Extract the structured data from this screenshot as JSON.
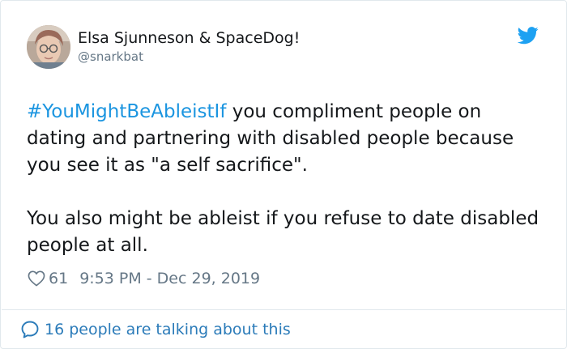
{
  "author": {
    "display_name": "Elsa Sjunneson & SpaceDog!",
    "handle": "@snarkbat"
  },
  "icons": {
    "brand": "twitter-bird-icon",
    "like": "heart-outline-icon",
    "conversation": "speech-bubble-icon"
  },
  "colors": {
    "brand": "#1da1f2",
    "hashtag": "#1b95e0",
    "footer_link": "#2b7bb9",
    "muted": "#657786"
  },
  "tweet": {
    "hashtag": "#YouMightBeAbleistIf",
    "paragraph1_rest": " you compliment people on dating and partnering with disabled people because you see it as \"a self sacrifice\".",
    "paragraph2": "You also might be ableist if you refuse to date disabled people at all."
  },
  "stats": {
    "like_count": "61",
    "timestamp": "9:53 PM - Dec 29, 2019"
  },
  "footer": {
    "conversation_text": "16 people are talking about this"
  }
}
